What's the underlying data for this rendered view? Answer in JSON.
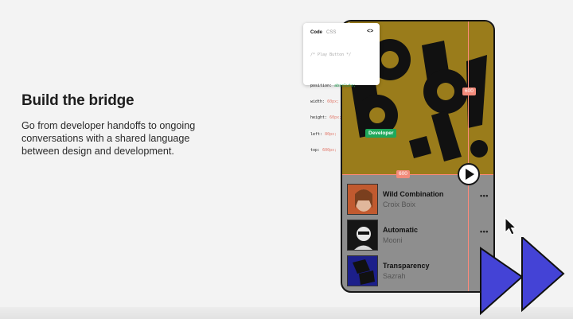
{
  "headline": "Build the bridge",
  "subcopy": "Go from developer handoffs to ongoing conversations with a shared language between design and development.",
  "colors": {
    "cover": "#9a7c1b",
    "guide": "#ff8a7a",
    "developer_tag": "#1fa85a",
    "arrow_fill": "#4443d6"
  },
  "code_panel": {
    "title": "Code",
    "language": "CSS",
    "toggle": "<>",
    "comment": "/* Play Button */",
    "props": [
      {
        "name": "position:",
        "value": "absolute;"
      },
      {
        "name": "width:",
        "value": "60px;"
      },
      {
        "name": "height:",
        "value": "60px;"
      },
      {
        "name": "left:",
        "value": "80px;"
      },
      {
        "name": "top:",
        "value": "600px;"
      }
    ]
  },
  "measure_labels": {
    "vertical": "600",
    "horizontal": "600"
  },
  "developer_tag": "Developer",
  "tracks": [
    {
      "title": "Wild Combination",
      "artist": "Croix Boix",
      "more": "•••"
    },
    {
      "title": "Automatic",
      "artist": "Mooni",
      "more": "•••"
    },
    {
      "title": "Transparency",
      "artist": "Sazrah",
      "more": "•••"
    }
  ],
  "icons": {
    "play": "play-icon",
    "cursor": "mouse-pointer-icon",
    "developer_cursor": "collaborator-cursor-icon",
    "decoration": "fast-forward-arrows-icon"
  }
}
